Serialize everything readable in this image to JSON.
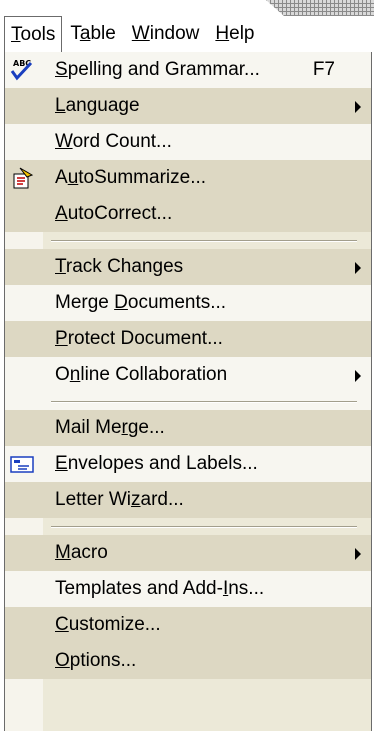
{
  "menubar": {
    "items": [
      {
        "pre": "",
        "key": "T",
        "post": "ools"
      },
      {
        "pre": "T",
        "key": "a",
        "post": "ble"
      },
      {
        "pre": "",
        "key": "W",
        "post": "indow"
      },
      {
        "pre": "",
        "key": "H",
        "post": "elp"
      }
    ]
  },
  "tools_menu": {
    "items": [
      {
        "pre": "",
        "key": "S",
        "post": "pelling and Grammar...",
        "shortcut": "F7",
        "icon": "spelling-abc-check-icon"
      },
      {
        "pre": "",
        "key": "L",
        "post": "anguage"
      },
      {
        "pre": "",
        "key": "W",
        "post": "ord Count..."
      },
      {
        "pre": "A",
        "key": "u",
        "post": "toSummarize...",
        "icon": "autosummarize-icon"
      },
      {
        "pre": "",
        "key": "A",
        "post": "utoCorrect..."
      },
      {
        "pre": "",
        "key": "T",
        "post": "rack Changes"
      },
      {
        "pre": "Merge ",
        "key": "D",
        "post": "ocuments..."
      },
      {
        "pre": "",
        "key": "P",
        "post": "rotect Document..."
      },
      {
        "pre": "O",
        "key": "n",
        "post": "line Collaboration"
      },
      {
        "pre": "Mail Me",
        "key": "r",
        "post": "ge..."
      },
      {
        "pre": "",
        "key": "E",
        "post": "nvelopes and Labels...",
        "icon": "envelope-label-icon"
      },
      {
        "pre": "Letter Wi",
        "key": "z",
        "post": "ard..."
      },
      {
        "pre": "",
        "key": "M",
        "post": "acro"
      },
      {
        "pre": "Templates and Add-",
        "key": "I",
        "post": "ns..."
      },
      {
        "pre": "",
        "key": "C",
        "post": "ustomize..."
      },
      {
        "pre": "",
        "key": "O",
        "post": "ptions..."
      }
    ]
  },
  "colors": {
    "menu_bg": "#ece9d8",
    "item_light": "#f7f6f0",
    "item_shade": "#ddd8c3",
    "border": "#6b6b6b"
  }
}
